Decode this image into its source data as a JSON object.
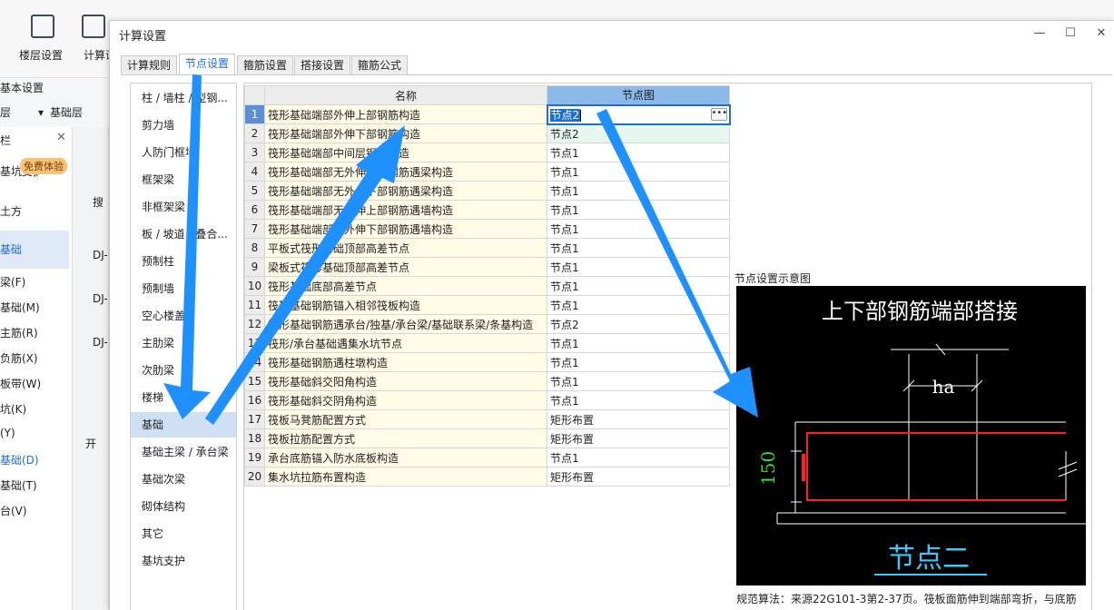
{
  "background_app": {
    "toolbar": [
      {
        "label": "楼层设置",
        "icon": "floor-settings-icon"
      },
      {
        "label": "计算设",
        "icon": "calc-settings-icon"
      }
    ],
    "section_label": "基本设置",
    "combo_left": "层",
    "combo_floor": "基础层",
    "panel_title": "栏",
    "badge": "免费体验",
    "panel_items": [
      "基坑支护",
      "土方",
      "基础",
      "梁(F)",
      "基础(M)",
      "主筋(R)",
      "负筋(X)",
      "板带(W)",
      "坑(K)",
      "(Y)",
      "基础(D)",
      "基础(T)",
      "台(V)"
    ],
    "col2_items": [
      "搜",
      "DJ-",
      "DJ-",
      "DJ-",
      "开"
    ]
  },
  "dialog": {
    "title": "计算设置",
    "window_buttons": [
      "—",
      "☐",
      "✕"
    ],
    "tabs": [
      "计算规则",
      "节点设置",
      "箍筋设置",
      "搭接设置",
      "箍筋公式"
    ],
    "active_tab": 1,
    "categories": [
      "柱 / 墙柱 / 型钢...",
      "剪力墙",
      "人防门框墙",
      "框架梁",
      "非框架梁",
      "板 / 坡道 / 叠合...",
      "预制柱",
      "预制墙",
      "空心楼盖",
      "主肋梁",
      "次肋梁",
      "楼梯",
      "基础",
      "基础主梁 / 承台梁",
      "基础次梁",
      "砌体结构",
      "其它",
      "基坑支护"
    ],
    "selected_category": 12,
    "table": {
      "columns": [
        "",
        "名称",
        "节点图"
      ],
      "editing_value": "节点2",
      "rows": [
        {
          "no": "1",
          "name": "筏形基础端部外伸上部钢筋构造",
          "node": "节点2"
        },
        {
          "no": "2",
          "name": "筏形基础端部外伸下部钢筋构造",
          "node": "节点2"
        },
        {
          "no": "3",
          "name": "筏形基础端部中间层钢筋构造",
          "node": "节点1"
        },
        {
          "no": "4",
          "name": "筏形基础端部无外伸上部钢筋遇梁构造",
          "node": "节点1"
        },
        {
          "no": "5",
          "name": "筏形基础端部无外伸下部钢筋遇梁构造",
          "node": "节点1"
        },
        {
          "no": "6",
          "name": "筏形基础端部无外伸上部钢筋遇墙构造",
          "node": "节点1"
        },
        {
          "no": "7",
          "name": "筏形基础端部无外伸下部钢筋遇墙构造",
          "node": "节点1"
        },
        {
          "no": "8",
          "name": "平板式筏形基础顶部高差节点",
          "node": "节点1"
        },
        {
          "no": "9",
          "name": "梁板式筏形基础顶部高差节点",
          "node": "节点1"
        },
        {
          "no": "10",
          "name": "筏形基础底部高差节点",
          "node": "节点1"
        },
        {
          "no": "11",
          "name": "筏形基础钢筋锚入相邻筏板构造",
          "node": "节点1"
        },
        {
          "no": "12",
          "name": "筏形基础钢筋遇承台/独基/承台梁/基础联系梁/条基构造",
          "node": "节点2"
        },
        {
          "no": "13",
          "name": "筏形/承台基础遇集水坑节点",
          "node": "节点1"
        },
        {
          "no": "14",
          "name": "筏形基础钢筋遇柱墩构造",
          "node": "节点1"
        },
        {
          "no": "15",
          "name": "筏形基础斜交阳角构造",
          "node": "节点1"
        },
        {
          "no": "16",
          "name": "筏形基础斜交阴角构造",
          "node": "节点1"
        },
        {
          "no": "17",
          "name": "筏板马凳筋配置方式",
          "node": "矩形布置"
        },
        {
          "no": "18",
          "name": "筏板拉筋配置方式",
          "node": "矩形布置"
        },
        {
          "no": "19",
          "name": "承台底筋锚入防水底板构造",
          "node": "节点1"
        },
        {
          "no": "20",
          "name": "集水坑拉筋布置构造",
          "node": "矩形布置"
        }
      ]
    },
    "preview": {
      "label": "节点设置示意图",
      "diagram_title": "上下部钢筋端部搭接",
      "dim_ha": "ha",
      "dim_150": "150",
      "node_caption": "节点二",
      "colors": {
        "background": "#000000",
        "text": "#ffffff",
        "rebar": "#ff2020",
        "dimension": "#33dd33",
        "caption": "#33ccff"
      }
    },
    "rule_text": "规范算法：来源22G101-3第2-37页。筏板面筋伸到端部弯折，与底筋"
  },
  "annotation_color": "#1e90ff"
}
